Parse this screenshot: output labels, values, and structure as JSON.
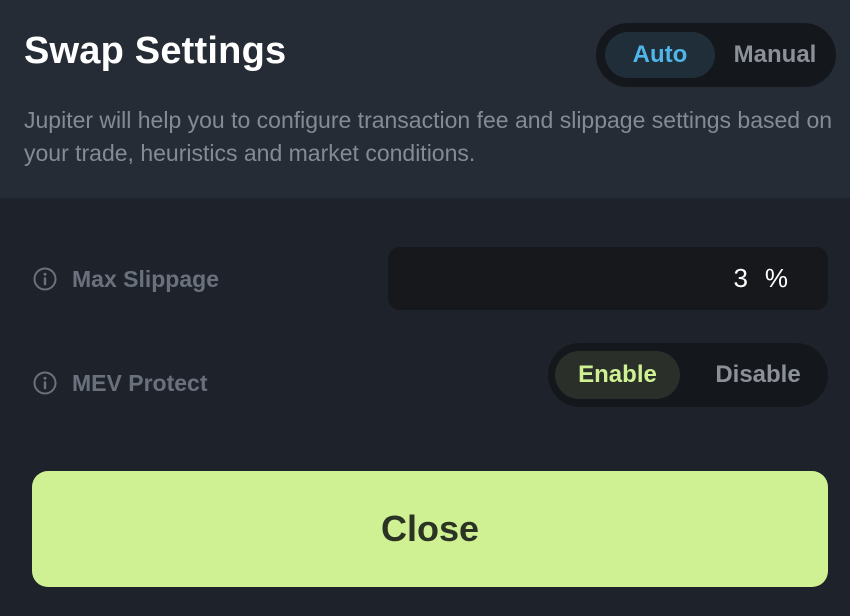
{
  "header": {
    "title": "Swap Settings",
    "mode_toggle": {
      "auto_label": "Auto",
      "manual_label": "Manual",
      "selected": "Auto"
    },
    "description": "Jupiter will help you to configure transaction fee and slippage settings based on your trade, heuristics and market conditions."
  },
  "settings": {
    "max_slippage": {
      "label": "Max Slippage",
      "value": "3",
      "unit": "%",
      "icon": "info-icon"
    },
    "mev_protect": {
      "label": "MEV Protect",
      "enable_label": "Enable",
      "disable_label": "Disable",
      "selected": "Enable",
      "icon": "info-icon"
    }
  },
  "actions": {
    "close_label": "Close"
  },
  "colors": {
    "background": "#1e232b",
    "header_background": "#262c36",
    "accent_blue": "#4fb5ea",
    "accent_green": "#d0f193",
    "enable_text": "#cff194"
  }
}
